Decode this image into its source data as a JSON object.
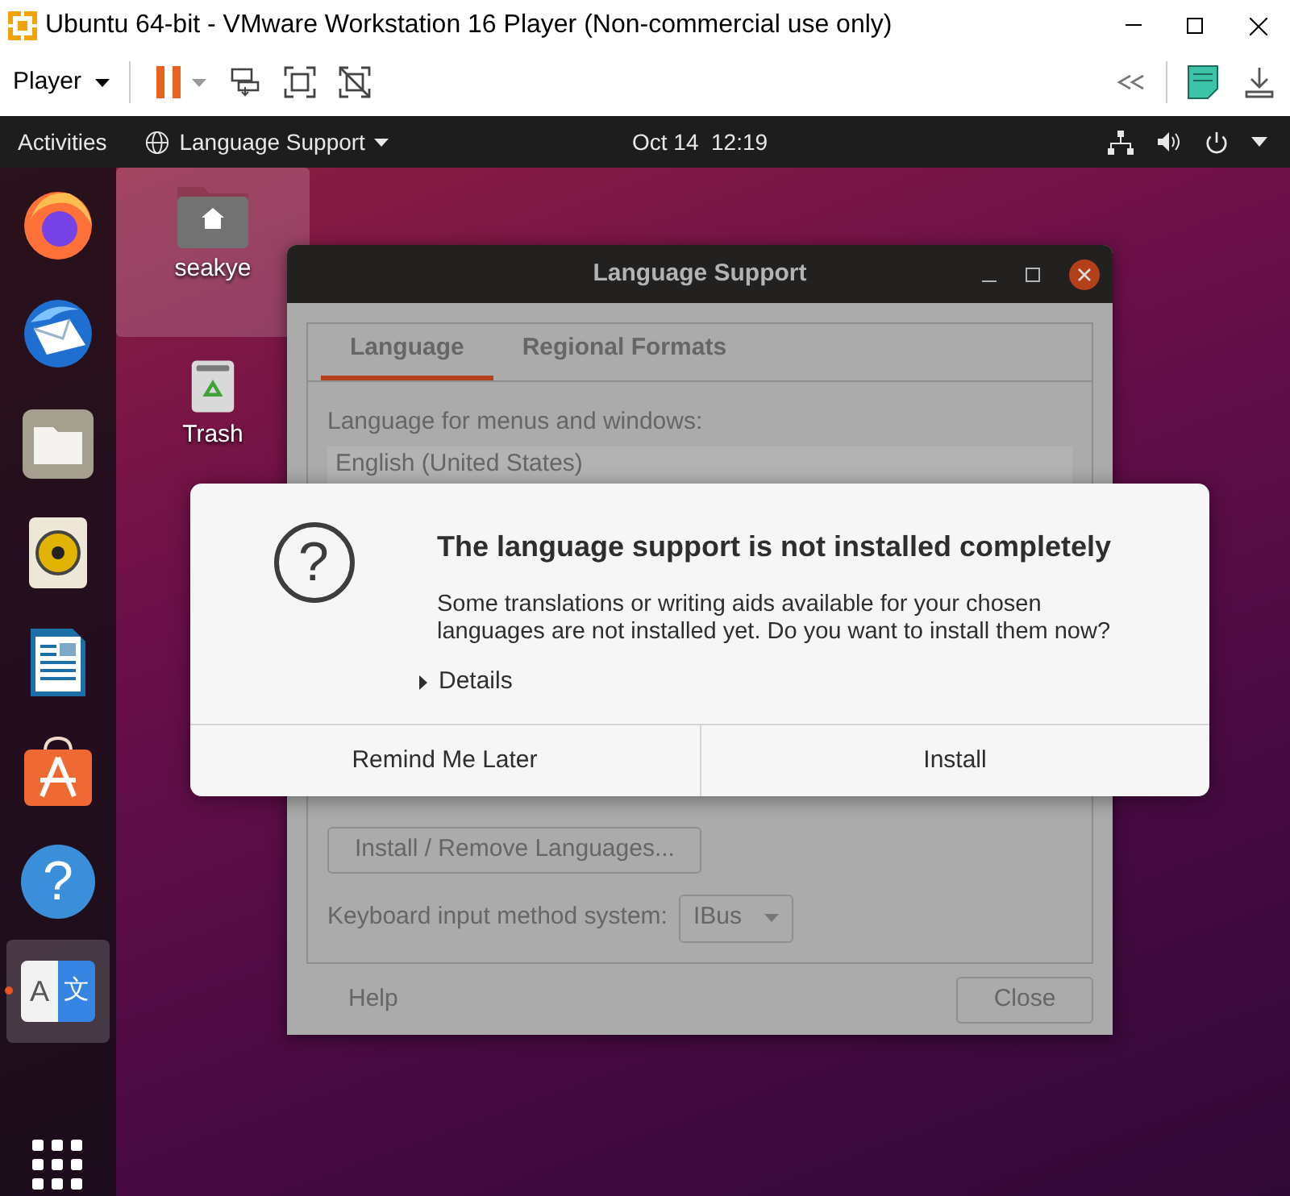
{
  "vm_window": {
    "title": "Ubuntu 64-bit - VMware Workstation 16 Player (Non-commercial use only)"
  },
  "vm_toolbar": {
    "player_menu": "Player"
  },
  "top_bar": {
    "activities": "Activities",
    "app_menu": "Language Support",
    "clock": "Oct 14  12:19"
  },
  "dock": {
    "items": [
      {
        "kind": "firefox",
        "active": false
      },
      {
        "kind": "thunderbird",
        "active": false
      },
      {
        "kind": "files",
        "active": false
      },
      {
        "kind": "rhythmbox",
        "active": false
      },
      {
        "kind": "writer",
        "active": false
      },
      {
        "kind": "software",
        "active": false
      },
      {
        "kind": "help",
        "glyph": "?",
        "active": false
      },
      {
        "kind": "language",
        "glyphs": [
          "A",
          "文"
        ],
        "active": true
      },
      {
        "kind": "apps",
        "active": false
      }
    ]
  },
  "desktop_icons": [
    {
      "kind": "home",
      "label": "seakye",
      "selected": true
    },
    {
      "kind": "trash",
      "label": "Trash",
      "selected": false
    }
  ],
  "language_window": {
    "title": "Language Support",
    "tabs": [
      {
        "label": "Language",
        "selected": true
      },
      {
        "label": "Regional Formats",
        "selected": false
      }
    ],
    "menu_language_label": "Language for menus and windows:",
    "languages": [
      "English (United States)"
    ],
    "install_remove_button": "Install / Remove Languages...",
    "input_method_label": "Keyboard input method system:",
    "input_method": "IBus",
    "help_button": "Help",
    "close_button": "Close"
  },
  "dialog": {
    "icon_glyph": "?",
    "title": "The language support is not installed completely",
    "message": "Some translations or writing aids available for your chosen languages are not installed yet. Do you want to install them now?",
    "details": {
      "label": "Details",
      "expanded": false
    },
    "buttons": [
      "Remind Me Later",
      "Install"
    ]
  }
}
